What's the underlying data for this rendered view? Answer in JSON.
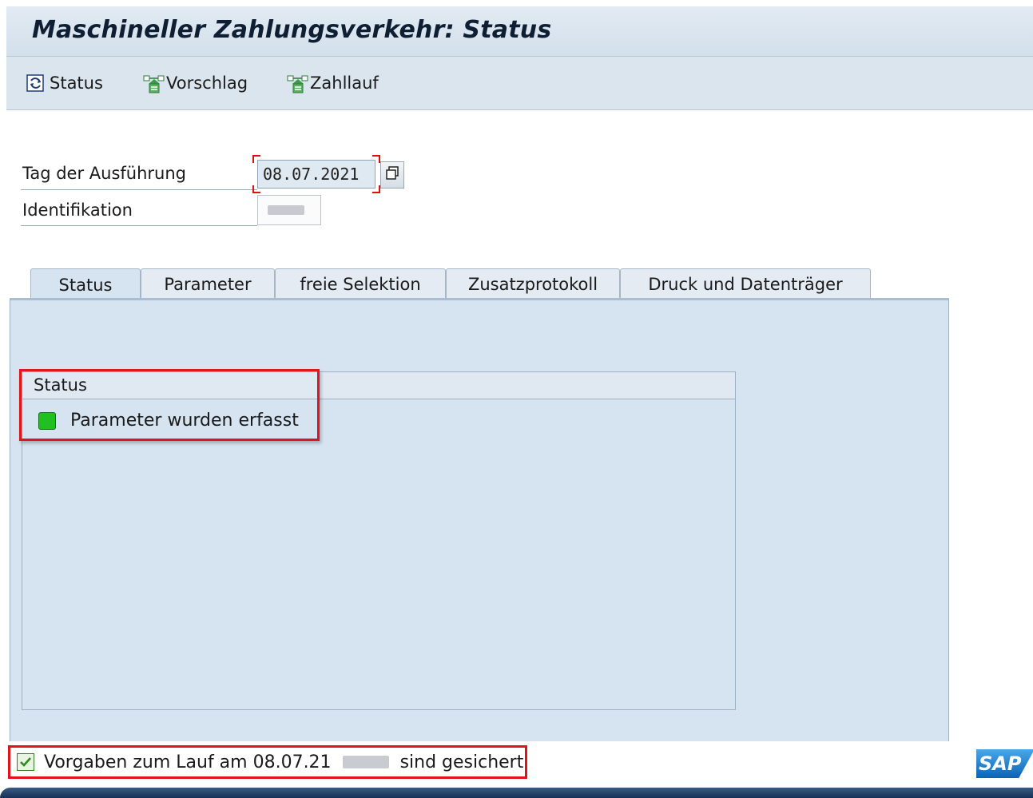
{
  "window": {
    "title": "Maschineller Zahlungsverkehr: Status"
  },
  "toolbar": {
    "status_label": "Status",
    "vorschlag_label": "Vorschlag",
    "zahllauf_label": "Zahllauf"
  },
  "form": {
    "tag_label": "Tag der Ausführung",
    "tag_value": "08.07.2021",
    "id_label": "Identifikation"
  },
  "tabs": [
    {
      "label": "Status",
      "active": true
    },
    {
      "label": "Parameter"
    },
    {
      "label": "freie Selektion"
    },
    {
      "label": "Zusatzprotokoll"
    },
    {
      "label": "Druck und Datenträger"
    }
  ],
  "status_group": {
    "title": "Status",
    "line": "Parameter wurden erfasst",
    "led_color": "#20c020"
  },
  "statusbar": {
    "message_prefix": "Vorgaben zum Lauf am 08.07.21",
    "message_suffix": "sind gesichert"
  },
  "brand": {
    "logo_text": "SAP"
  },
  "colors": {
    "highlight": "#e0141a",
    "panel": "#d6e4f1"
  }
}
